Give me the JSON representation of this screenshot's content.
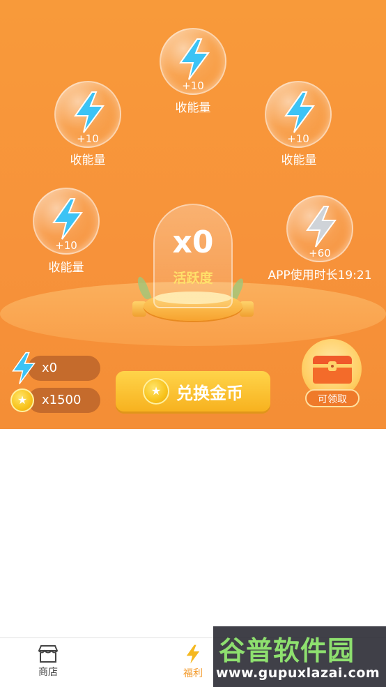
{
  "bubbles": [
    {
      "amount": "+10",
      "label": "收能量",
      "icon": "lightning-bolt-blue"
    },
    {
      "amount": "+10",
      "label": "收能量",
      "icon": "lightning-bolt-blue"
    },
    {
      "amount": "+10",
      "label": "收能量",
      "icon": "lightning-bolt-blue"
    },
    {
      "amount": "+10",
      "label": "收能量",
      "icon": "lightning-bolt-blue"
    },
    {
      "amount": "+60",
      "label": "APP使用时长19:21",
      "icon": "lightning-bolt-gray"
    }
  ],
  "activity": {
    "count": "x0",
    "label": "活跃度"
  },
  "balances": {
    "energy": "x0",
    "coins": "x1500"
  },
  "exchange_button": {
    "label": "兑换金币"
  },
  "chest": {
    "badge": "可领取"
  },
  "nav": {
    "shop": "商店",
    "welfare": "福利"
  },
  "watermark": {
    "title": "谷普软件园",
    "url": "www.gupuxlazai.com"
  },
  "colors": {
    "hero": "#f7923a",
    "bolt_blue": "#3cc3f5",
    "bolt_gray": "#cfd3d8",
    "coin": "#f8c31c",
    "accent": "#f39a2a"
  }
}
